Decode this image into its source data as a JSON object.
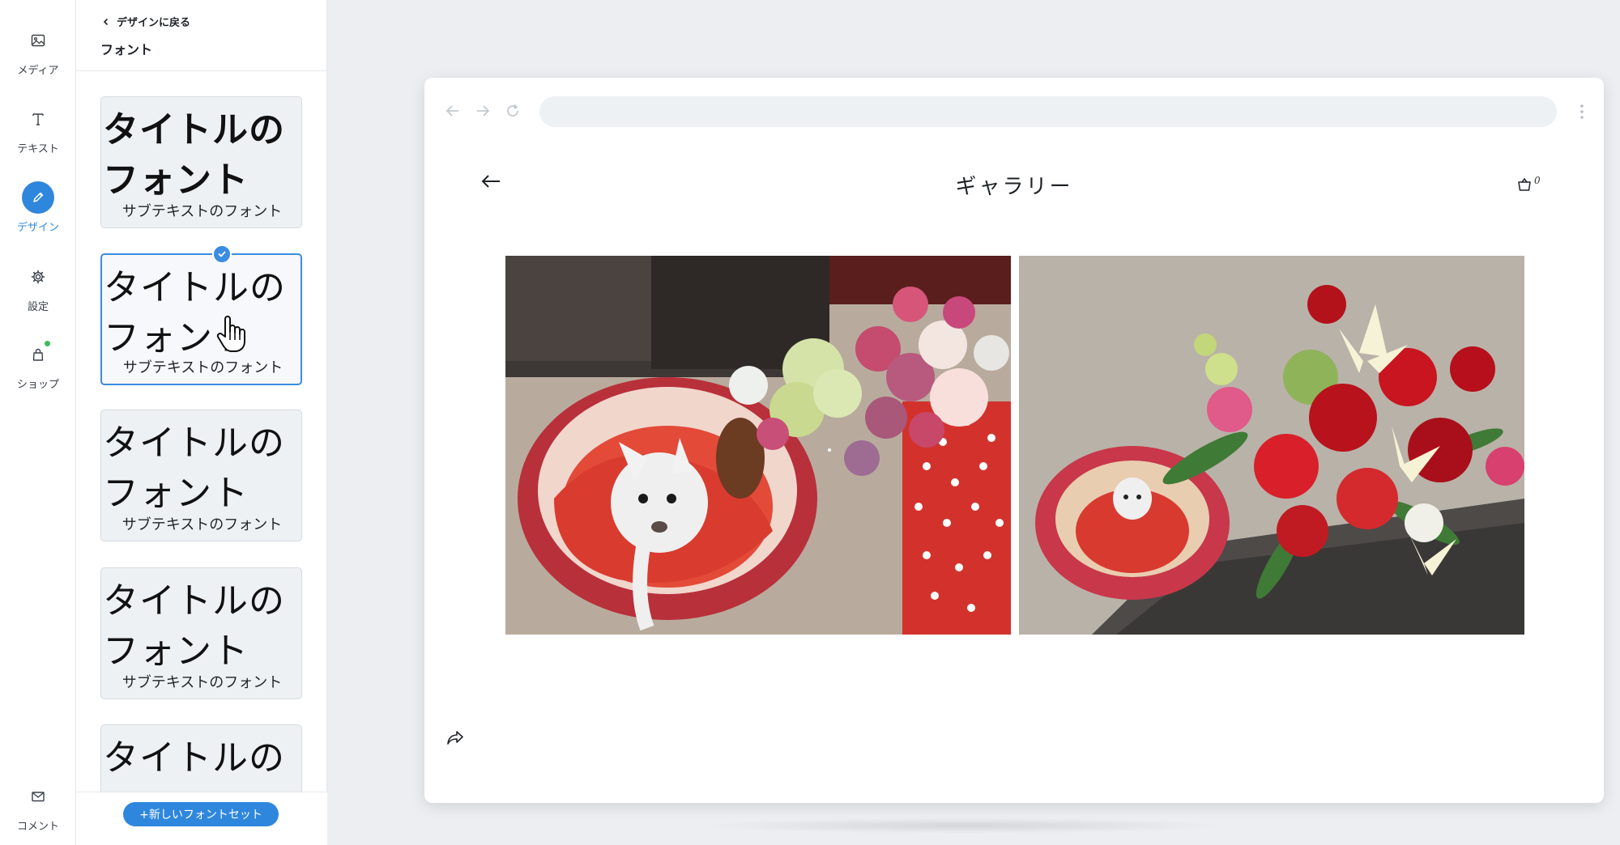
{
  "rail": {
    "items": [
      {
        "label": "メディア",
        "icon": "image-icon"
      },
      {
        "label": "テキスト",
        "icon": "text-icon"
      },
      {
        "label": "デザイン",
        "icon": "pen-icon",
        "active": true
      },
      {
        "label": "設定",
        "icon": "gear-icon"
      },
      {
        "label": "ショップ",
        "icon": "bag-icon"
      },
      {
        "label": "コメント",
        "icon": "mail-icon"
      }
    ]
  },
  "panel": {
    "back_label": "デザインに戻る",
    "title": "フォント",
    "cards": [
      {
        "title": "タイトルのフォント",
        "subtitle": "サブテキストのフォント"
      },
      {
        "title": "タイトルのフォント",
        "subtitle": "サブテキストのフォント"
      },
      {
        "title": "タイトルのフォント",
        "subtitle": "サブテキストのフォント"
      },
      {
        "title": "タイトルのフォント",
        "subtitle": "サブテキストのフォント"
      },
      {
        "title": "タイトルのフォント",
        "subtitle": ""
      }
    ],
    "new_fontset_label": "+新しいフォントセット"
  },
  "preview": {
    "site_title": "ギャラリー",
    "cart_count": "0"
  },
  "colors": {
    "accent": "#2f87dd",
    "notify": "#3dbb5a",
    "rail_bg": "#ffffff",
    "canvas_bg": "#eceef1"
  }
}
